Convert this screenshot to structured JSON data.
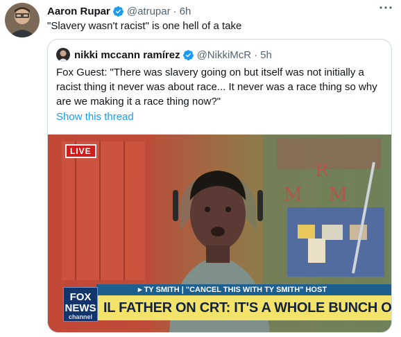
{
  "tweet": {
    "author_name": "Aaron Rupar",
    "handle": "@atrupar",
    "separator": "·",
    "time": "6h",
    "text": "\"Slavery wasn't racist\" is one hell of a take"
  },
  "quoted": {
    "author_name": "nikki mccann ramírez",
    "handle": "@NikkiMcR",
    "separator": "·",
    "time": "5h",
    "text": "Fox Guest: \"There was slavery going on but itself was not initially a racist thing it never was about race... It never was a race thing so why are we making it a race thing now?\"",
    "show_thread": "Show this thread"
  },
  "video": {
    "live_label": "LIVE",
    "lower_third_top": "▸ TY SMITH | \"CANCEL THIS WITH TY SMITH\" HOST",
    "headline": "IL FATHER ON CRT: IT'S A WHOLE BUNCH OF NONSENSE",
    "logo_line1": "FOX",
    "logo_line2": "NEWS",
    "logo_line3": "channel"
  },
  "icons": {
    "verified": "verified-badge-icon",
    "more": "more-options-icon"
  },
  "colors": {
    "link": "#1d9bf0",
    "verified": "#1d9bf0",
    "muted": "#536471",
    "banner_yellow": "#f3e36a",
    "banner_blue": "#1d5f8f"
  }
}
